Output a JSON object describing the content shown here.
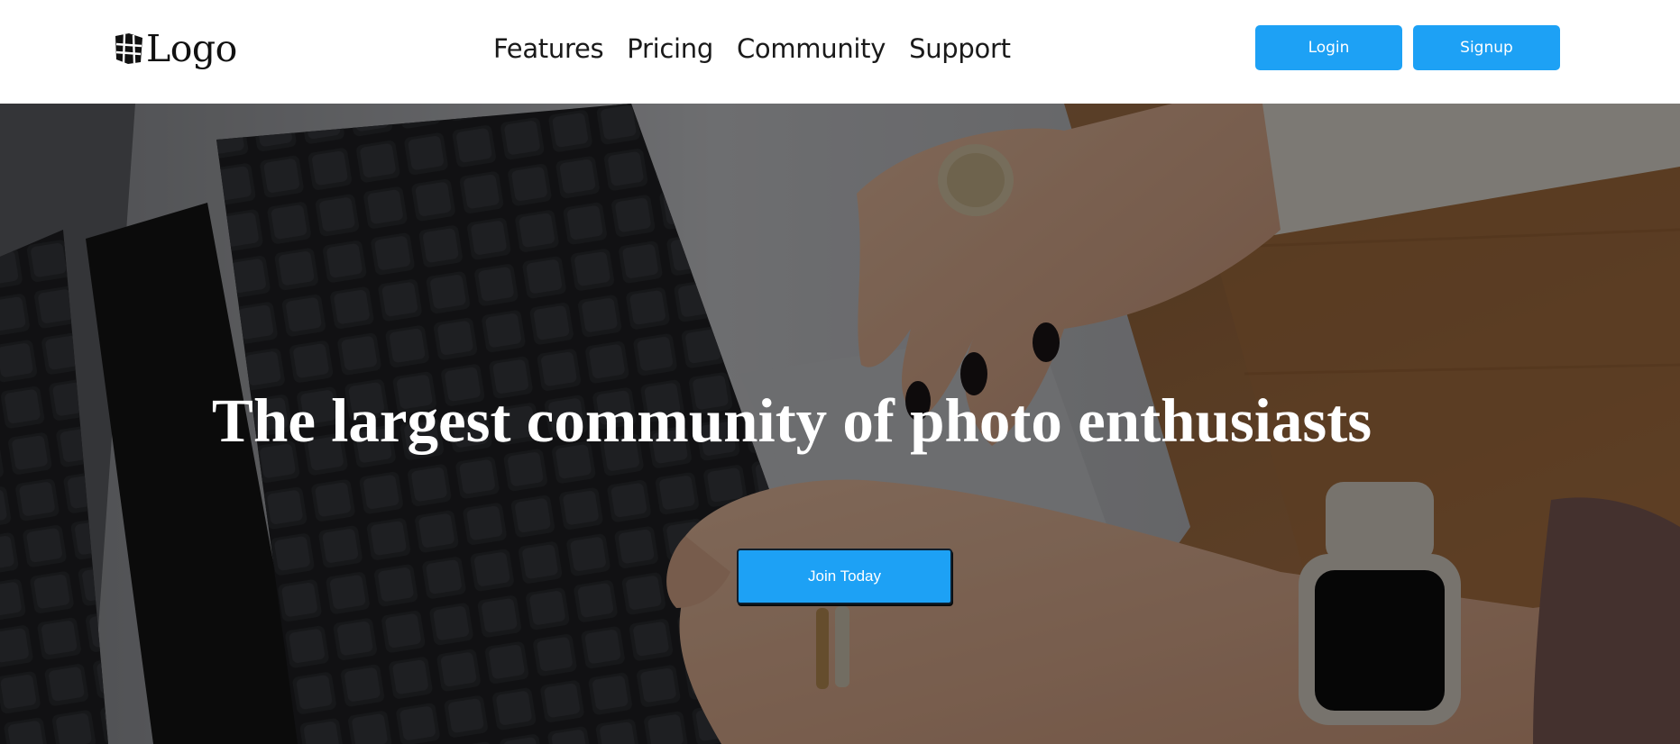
{
  "header": {
    "logo_text": "Logo",
    "logo_icon": "cube-logo-icon",
    "nav": [
      {
        "label": "Features"
      },
      {
        "label": "Pricing"
      },
      {
        "label": "Community"
      },
      {
        "label": "Support"
      }
    ],
    "login_label": "Login",
    "signup_label": "Signup"
  },
  "hero": {
    "title": "The largest community of photo enthusiasts",
    "cta_label": "Join Today",
    "background": "photo of hands typing on a laptop keyboard on a wooden desk"
  },
  "colors": {
    "accent": "#1da1f5",
    "header_bg": "#ffffff",
    "hero_text": "#ffffff"
  }
}
